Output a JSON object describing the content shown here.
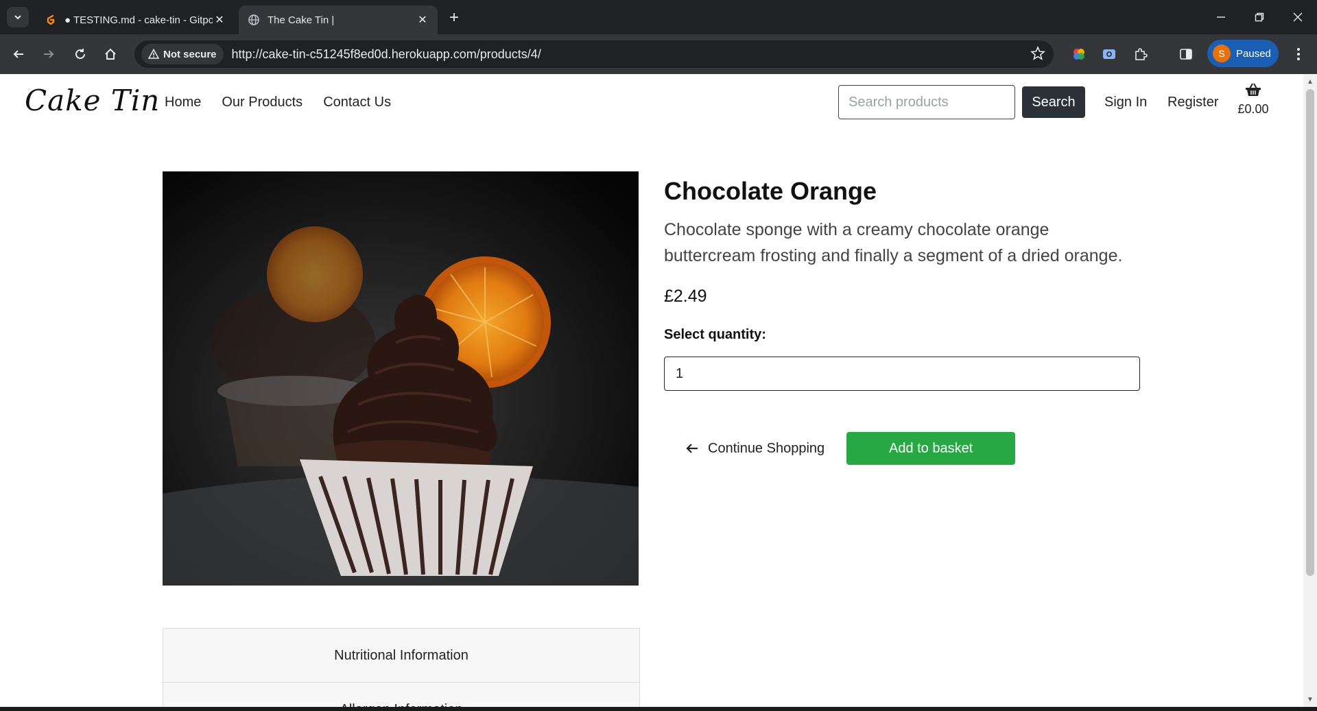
{
  "browser": {
    "tabs": [
      {
        "title": "● TESTING.md - cake-tin - Gitpod",
        "icon": "gitpod-icon",
        "active": false
      },
      {
        "title": "The Cake Tin |",
        "icon": "globe-icon",
        "active": true
      }
    ],
    "security_label": "Not secure",
    "url": "http://cake-tin-c51245f8ed0d.herokuapp.com/products/4/",
    "profile_initial": "S",
    "profile_status": "Paused"
  },
  "site": {
    "logo": "Cake Tin",
    "nav": [
      "Home",
      "Our Products",
      "Contact Us"
    ],
    "search": {
      "placeholder": "Search products",
      "button": "Search"
    },
    "account": {
      "sign_in": "Sign In",
      "register": "Register"
    },
    "basket": {
      "total": "£0.00",
      "icon": "basket-icon"
    }
  },
  "product": {
    "name": "Chocolate Orange",
    "description": "Chocolate sponge with a creamy chocolate orange buttercream frosting and finally a segment of a dried orange.",
    "price": "£2.49",
    "quantity_label": "Select quantity:",
    "quantity_value": "1",
    "continue_label": "Continue Shopping",
    "add_label": "Add to basket",
    "image_alt": "chocolate cupcake with dried orange slice"
  },
  "accordion": {
    "items": [
      "Nutritional Information",
      "Allergen Information"
    ]
  },
  "colors": {
    "add_button": "#28a745",
    "search_button": "#2c3138",
    "chrome_dark": "#202124",
    "chrome_toolbar": "#35363a"
  }
}
